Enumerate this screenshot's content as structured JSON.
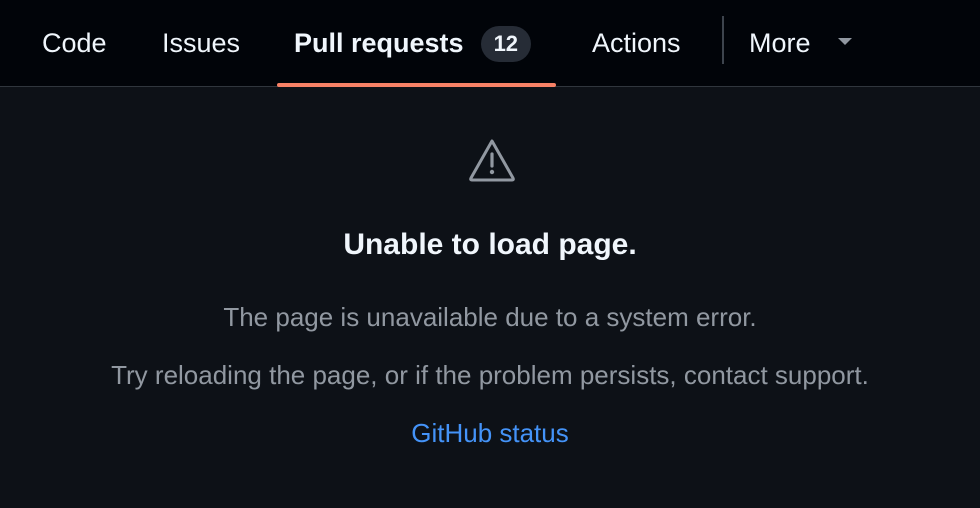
{
  "nav": {
    "tabs": {
      "code": "Code",
      "issues": "Issues",
      "pulls": "Pull requests",
      "pulls_count": "12",
      "actions": "Actions",
      "more": "More"
    },
    "selected_tab": "Pull requests",
    "underline_color": "#f78166"
  },
  "error": {
    "icon": "alert-triangle-icon",
    "title": "Unable to load page.",
    "line1": "The page is unavailable due to a system error.",
    "line2": "Try reloading the page, or if the problem persists, contact support.",
    "link": "GitHub status"
  },
  "colors": {
    "background": "#0d1117",
    "nav_background": "#010409",
    "link": "#4493f8"
  }
}
